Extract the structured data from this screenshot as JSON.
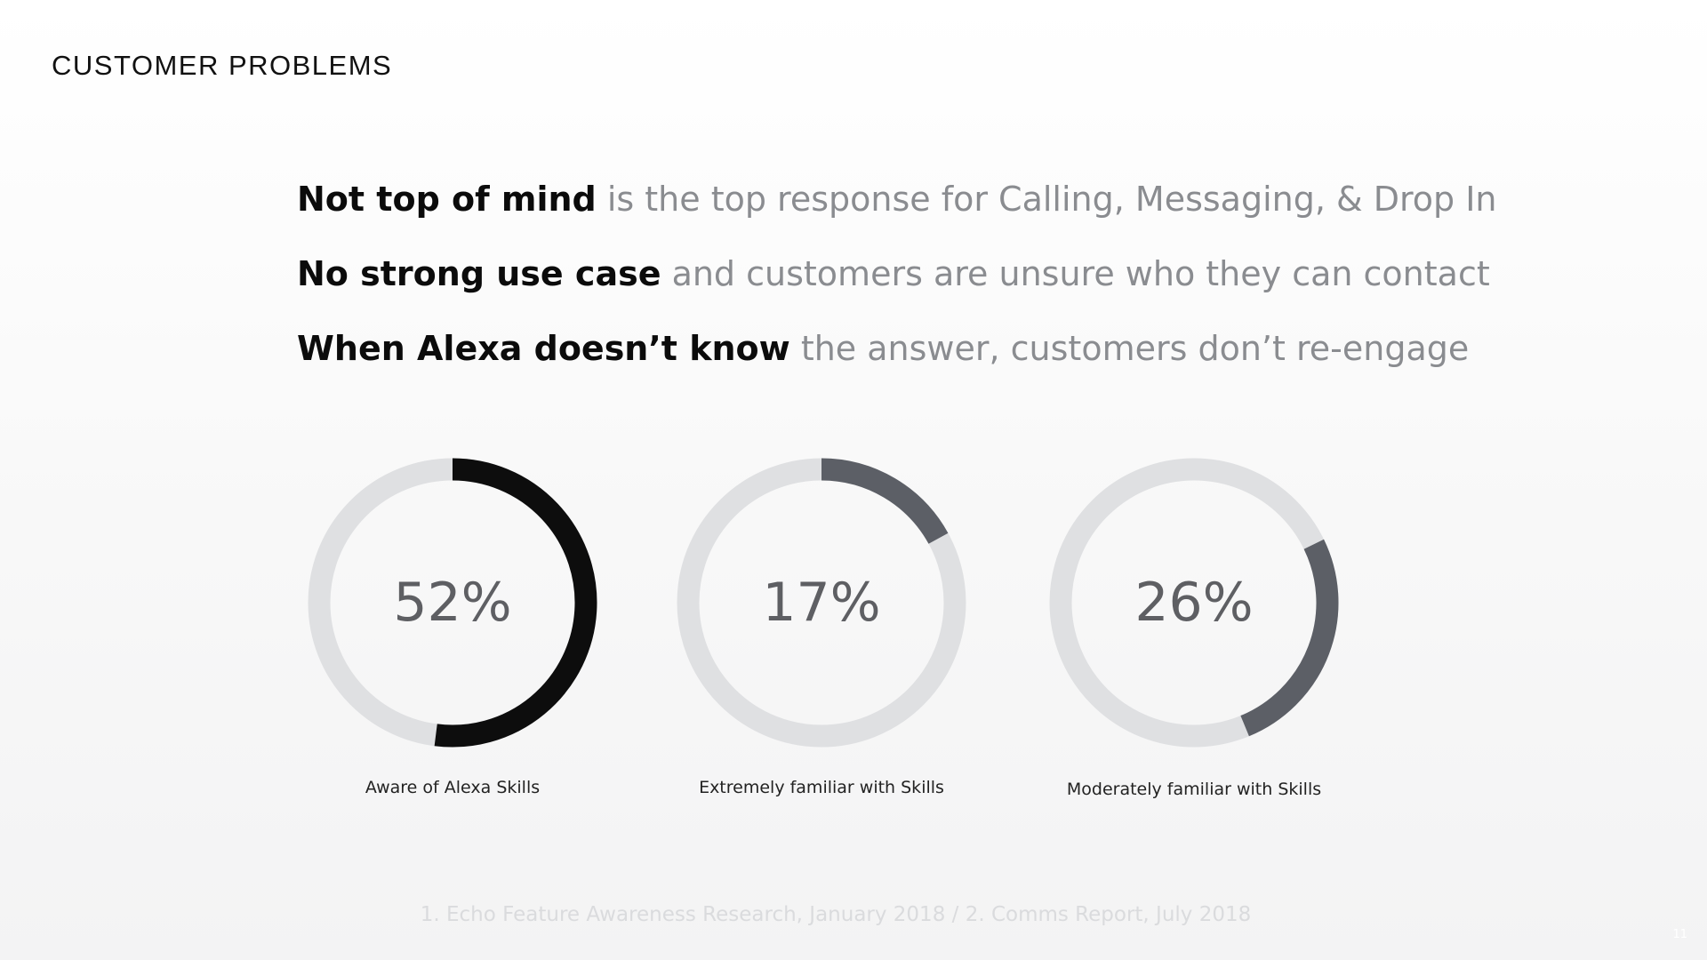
{
  "slide": {
    "title": "CUSTOMER PROBLEMS",
    "problems": [
      {
        "bold": "Not top of mind",
        "rest": " is the top response for Calling, Messaging, & Drop In"
      },
      {
        "bold": "No strong use case",
        "rest": " and customers are unsure who they can contact"
      },
      {
        "bold": "When Alexa doesn’t know",
        "rest": " the answer, customers don’t re-engage"
      }
    ],
    "footnote": "1. Echo Feature Awareness Research, January 2018 / 2. Comms Report, July 2018",
    "page_number": "11"
  },
  "colors": {
    "track": "#dfe0e2",
    "primary_fill": "#0d0d0d",
    "secondary_fill": "#5c5f66",
    "center_text": "#5e5f63"
  },
  "chart_data": [
    {
      "type": "pie",
      "variant": "donut",
      "value_percent": 52,
      "label": "52%",
      "caption": "Aware of Alexa Skills",
      "start_angle_deg": 0,
      "fill": "primary"
    },
    {
      "type": "pie",
      "variant": "donut",
      "value_percent": 17,
      "label": "17%",
      "caption": "Extremely familiar with Skills",
      "start_angle_deg": 0,
      "fill": "secondary"
    },
    {
      "type": "pie",
      "variant": "donut",
      "value_percent": 26,
      "label": "26%",
      "caption": "Moderately familiar with Skills",
      "start_angle_deg": 64,
      "fill": "secondary"
    }
  ]
}
